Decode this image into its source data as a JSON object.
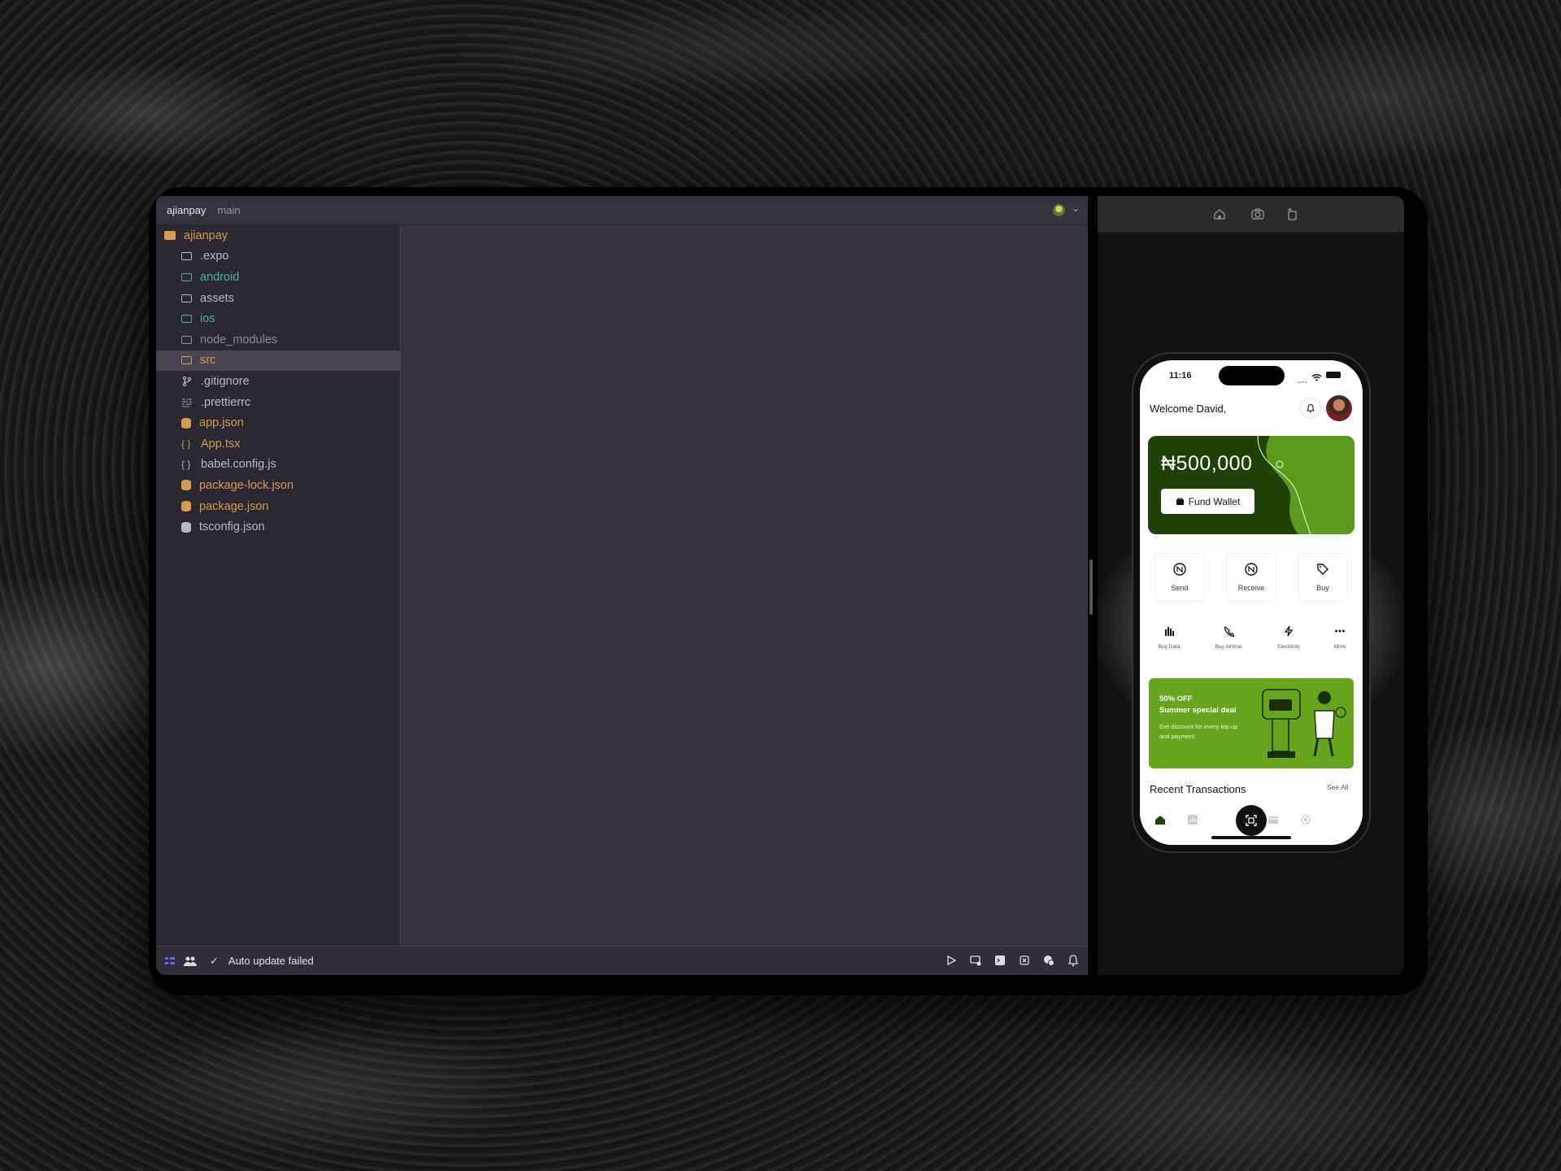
{
  "ide": {
    "project_name": "ajianpay",
    "branch": "main",
    "file_tree": [
      {
        "label": "ajianpay",
        "kind": "root-folder",
        "color": "#d89a4c"
      },
      {
        "label": ".expo",
        "kind": "folder",
        "color": "#bcb8c2"
      },
      {
        "label": "android",
        "kind": "folder",
        "color": "#41b3a5"
      },
      {
        "label": "assets",
        "kind": "folder",
        "color": "#bcb8c2"
      },
      {
        "label": "ios",
        "kind": "folder",
        "color": "#41b3a5"
      },
      {
        "label": "node_modules",
        "kind": "folder",
        "color": "#8f8a96"
      },
      {
        "label": "src",
        "kind": "folder",
        "color": "#d89a4c",
        "selected": true
      },
      {
        "label": ".gitignore",
        "kind": "git",
        "color": "#bcb8c2"
      },
      {
        "label": ".prettierrc",
        "kind": "config",
        "color": "#bcb8c2"
      },
      {
        "label": "app.json",
        "kind": "json",
        "color": "#d89a4c"
      },
      {
        "label": "App.tsx",
        "kind": "braces",
        "color": "#d89a4c"
      },
      {
        "label": "babel.config.js",
        "kind": "braces",
        "color": "#bcb8c2"
      },
      {
        "label": "package-lock.json",
        "kind": "json",
        "color": "#d89a4c"
      },
      {
        "label": "package.json",
        "kind": "json",
        "color": "#d89a4c"
      },
      {
        "label": "tsconfig.json",
        "kind": "json",
        "color": "#bcb8c2"
      }
    ],
    "status": {
      "check": "✓",
      "message": "Auto update failed"
    },
    "status_icons": [
      "run-icon",
      "devices-icon",
      "terminal-icon",
      "debug-icon",
      "chat-icon",
      "bell-icon"
    ]
  },
  "simulator": {
    "toolbar_icons": [
      "home-icon",
      "screenshot-icon",
      "rotate-icon"
    ]
  },
  "app": {
    "time": "11:16",
    "welcome": "Welcome David,",
    "balance": "₦500,000",
    "fund_wallet": "Fund Wallet",
    "quick_actions": [
      {
        "label": "Send",
        "icon": "send-naira-icon"
      },
      {
        "label": "Receive",
        "icon": "receive-naira-icon"
      },
      {
        "label": "Buy",
        "icon": "tag-icon"
      }
    ],
    "services": [
      {
        "label": "Buy Data",
        "icon": "data-icon"
      },
      {
        "label": "Buy Airtime",
        "icon": "phone-icon"
      },
      {
        "label": "Electricity",
        "icon": "bolt-icon"
      },
      {
        "label": "More",
        "icon": "more-icon"
      }
    ],
    "promo": {
      "title": "50% OFF",
      "subtitle": "Summer special deal",
      "description": "Get discount for every top up and payment"
    },
    "recent_title": "Recent Transactions",
    "see_all": "See All",
    "colors": {
      "brand_dark": "#1f4209",
      "brand_green": "#67a51e"
    }
  }
}
